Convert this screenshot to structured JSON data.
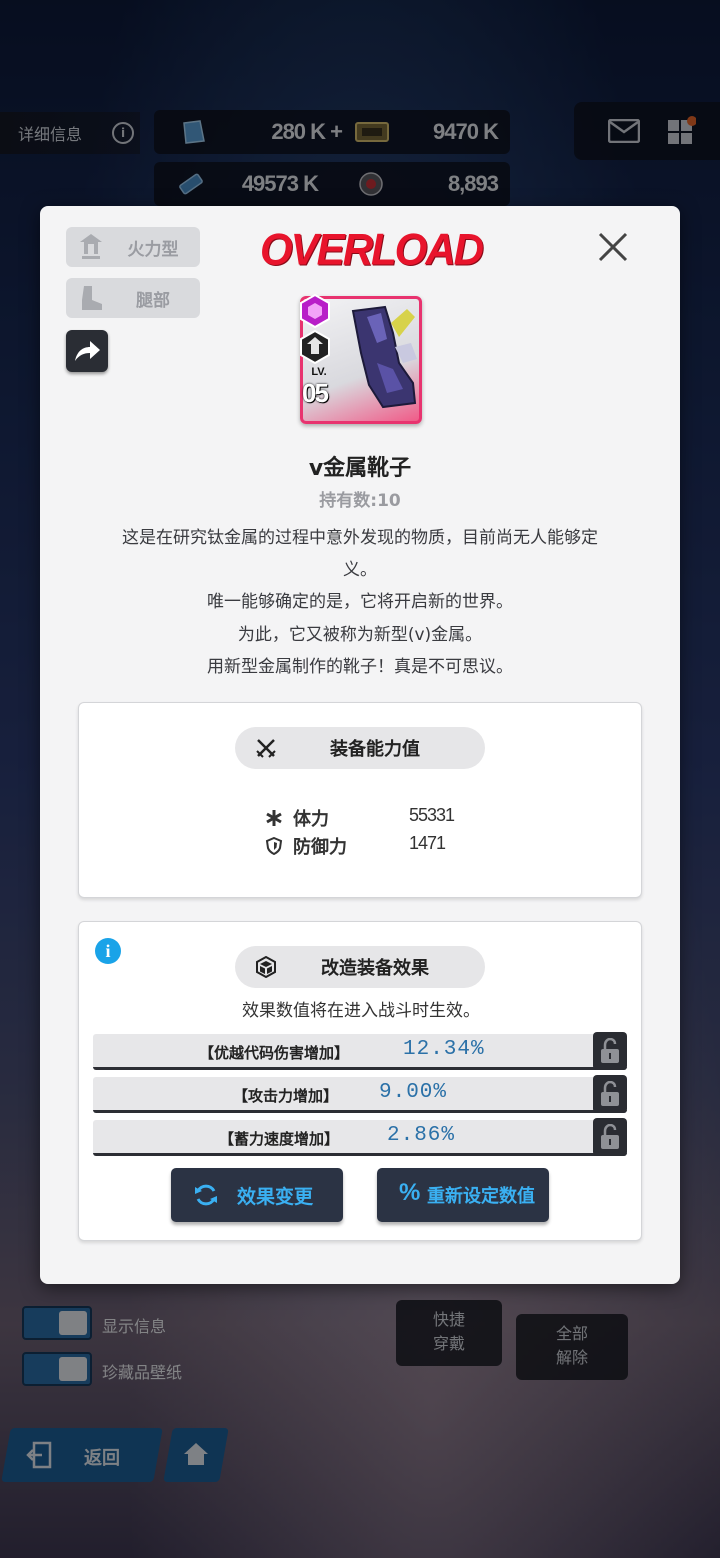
{
  "hud": {
    "info_label": "详细信息",
    "resources": [
      {
        "icon": "crystal-icon",
        "value": "280 K +"
      },
      {
        "icon": "card-icon",
        "value": "9470 K"
      },
      {
        "icon": "battery-icon",
        "value": "49573 K"
      },
      {
        "icon": "orb-icon",
        "value": "8,893"
      }
    ],
    "mail_icon": "mail-icon",
    "menu_icon": "grid-menu-icon"
  },
  "background_ui": {
    "toggle_1_label": "显示信息",
    "toggle_2_label": "珍藏品壁纸",
    "quick_equip": "快捷\n穿戴",
    "unequip_all": "全部\n解除",
    "back_label": "返回"
  },
  "modal": {
    "logo": "OVERLOAD",
    "tags": [
      {
        "icon": "firepower-icon",
        "label": "火力型"
      },
      {
        "icon": "boot-icon",
        "label": "腿部"
      }
    ],
    "card": {
      "lv_label": "LV.",
      "lv_value": "05"
    },
    "item_name": "v金属靴子",
    "owned": "持有数:10",
    "description": [
      "这是在研究钛金属的过程中意外发现的物质，目前尚无人能够定",
      "义。",
      "唯一能够确定的是，它将开启新的世界。",
      "为此，它又被称为新型(v)金属。",
      "用新型金属制作的靴子！真是不可思议。"
    ],
    "equip_stats": {
      "title": "装备能力值",
      "stats": [
        {
          "icon": "asterisk-icon",
          "label": "体力",
          "value": "55331"
        },
        {
          "icon": "shield-icon",
          "label": "防御力",
          "value": "1471"
        }
      ]
    },
    "modify_effects": {
      "title": "改造装备效果",
      "note": "效果数值将在进入战斗时生效。",
      "effects": [
        {
          "name": "【优越代码伤害增加】",
          "value": "12.34%"
        },
        {
          "name": "【攻击力增加】",
          "value": "9.00%"
        },
        {
          "name": "【蓄力速度增加】",
          "value": "2.86%"
        }
      ],
      "change_button": "效果变更",
      "reset_button": "重新设定数值"
    }
  },
  "colors": {
    "logo_red": "#e8142c",
    "accent_blue": "#3ab0f2",
    "value_blue": "#2b71a8",
    "card_pink": "#e8336f"
  }
}
